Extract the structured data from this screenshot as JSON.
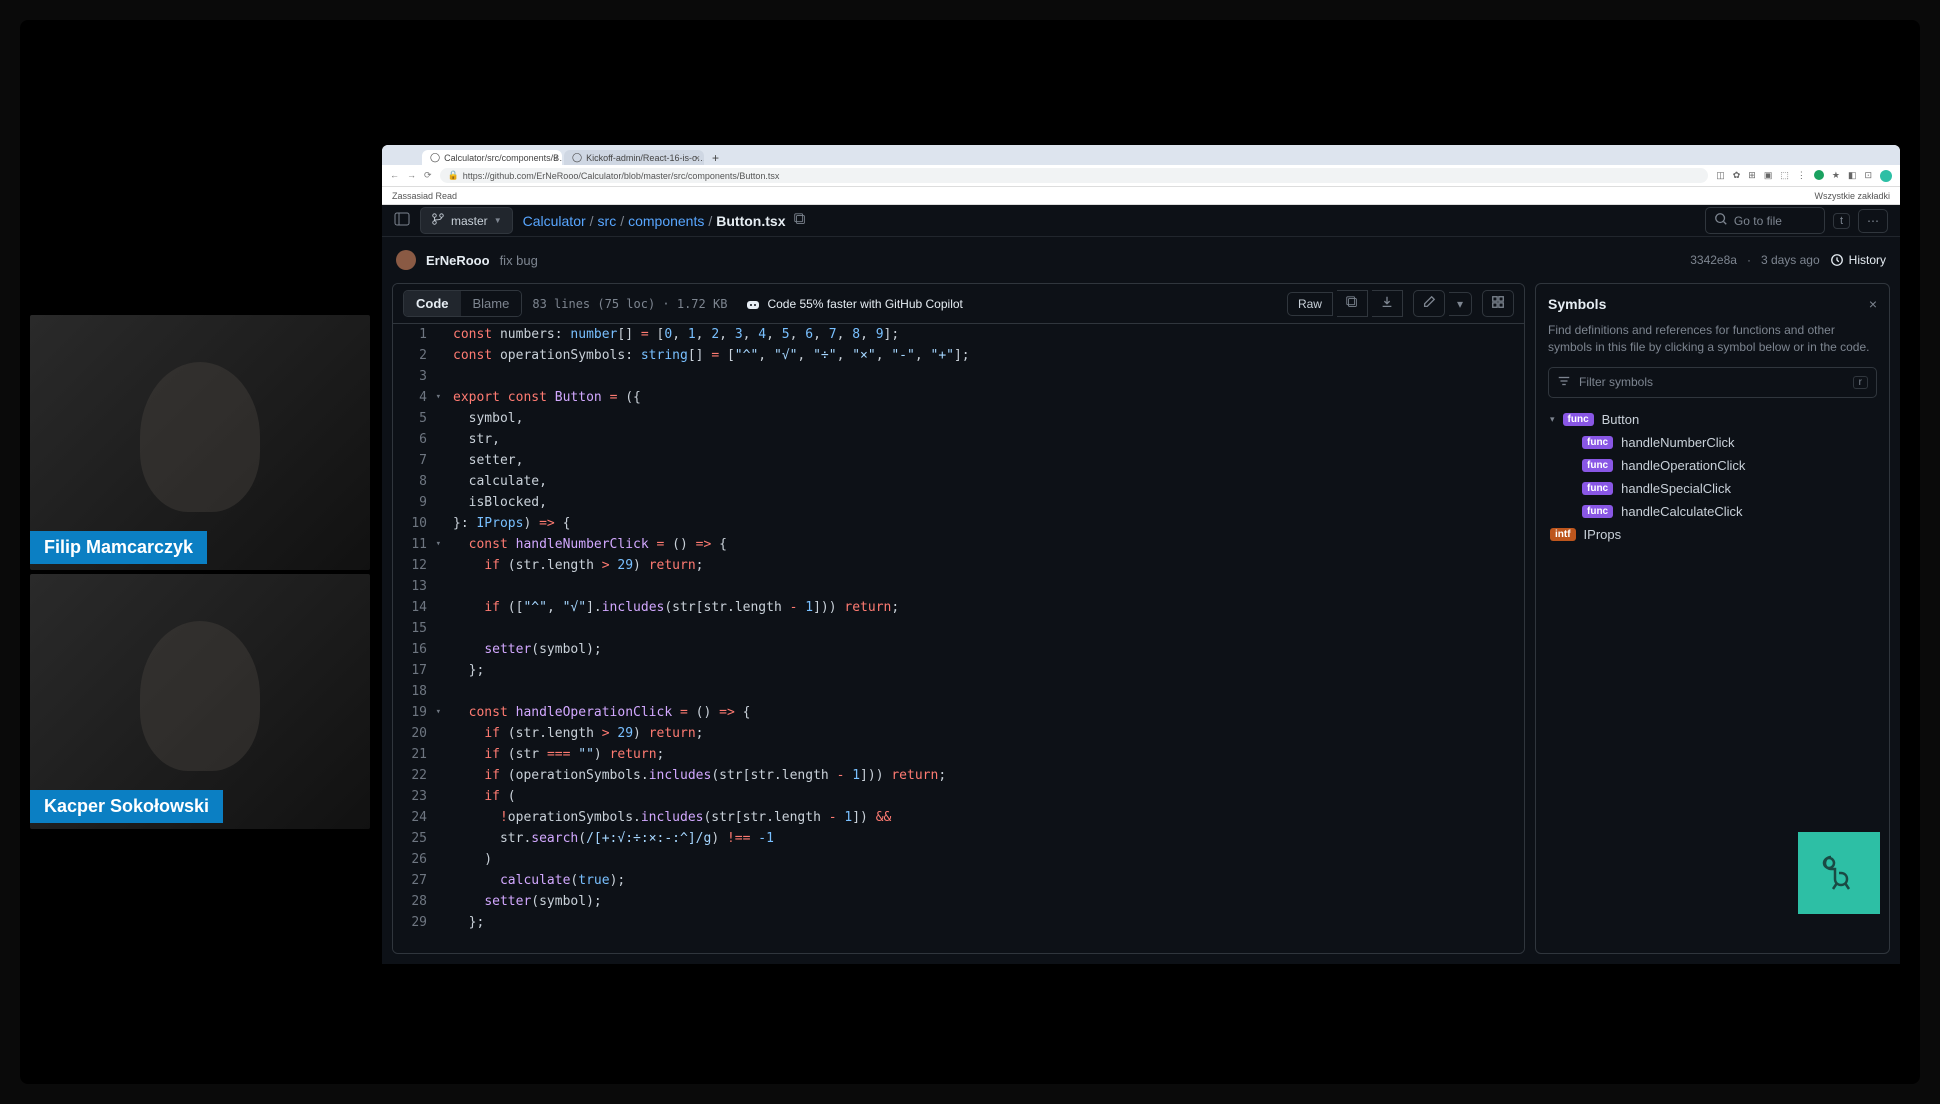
{
  "webcams": [
    {
      "name": "Filip Mamcarczyk"
    },
    {
      "name": "Kacper Sokołowski"
    }
  ],
  "browser": {
    "tabs": [
      {
        "title": "Calculator/src/components/B…",
        "active": true
      },
      {
        "title": "Kickoff-admin/React-16-is-o…",
        "active": false
      }
    ],
    "url": "https://github.com/ErNeRooo/Calculator/blob/master/src/components/Button.tsx",
    "bookmark_left": "Zassasiad Read",
    "bookmark_right": "Wszystkie zakładki"
  },
  "repo": {
    "branch": "master",
    "breadcrumb": {
      "root": "Calculator",
      "dir1": "src",
      "dir2": "components",
      "file": "Button.tsx"
    },
    "goto_placeholder": "Go to file",
    "shortcut_t": "t"
  },
  "commit": {
    "author": "ErNeRooo",
    "message": "fix bug",
    "sha": "3342e8a",
    "age": "3 days ago",
    "history": "History"
  },
  "code_header": {
    "tab_code": "Code",
    "tab_blame": "Blame",
    "file_meta": "83 lines (75 loc) · 1.72 KB",
    "copilot": "Code 55% faster with GitHub Copilot",
    "raw": "Raw"
  },
  "code": [
    {
      "n": 1,
      "fold": "",
      "html": "<span class='kw'>const</span> <span class='vr'>numbers</span>: <span class='ty'>number</span>[] <span class='op'>=</span> [<span class='nm'>0</span>, <span class='nm'>1</span>, <span class='nm'>2</span>, <span class='nm'>3</span>, <span class='nm'>4</span>, <span class='nm'>5</span>, <span class='nm'>6</span>, <span class='nm'>7</span>, <span class='nm'>8</span>, <span class='nm'>9</span>];"
    },
    {
      "n": 2,
      "fold": "",
      "html": "<span class='kw'>const</span> <span class='vr'>operationSymbols</span>: <span class='ty'>string</span>[] <span class='op'>=</span> [<span class='st'>\"^\"</span>, <span class='st'>\"√\"</span>, <span class='st'>\"÷\"</span>, <span class='st'>\"×\"</span>, <span class='st'>\"-\"</span>, <span class='st'>\"+\"</span>];"
    },
    {
      "n": 3,
      "fold": "",
      "html": ""
    },
    {
      "n": 4,
      "fold": "v",
      "html": "<span class='kw'>export</span> <span class='kw'>const</span> <span class='fn'>Button</span> <span class='op'>=</span> ({"
    },
    {
      "n": 5,
      "fold": "",
      "html": "  symbol,"
    },
    {
      "n": 6,
      "fold": "",
      "html": "  str,"
    },
    {
      "n": 7,
      "fold": "",
      "html": "  setter,"
    },
    {
      "n": 8,
      "fold": "",
      "html": "  calculate,"
    },
    {
      "n": 9,
      "fold": "",
      "html": "  isBlocked,"
    },
    {
      "n": 10,
      "fold": "",
      "html": "}: <span class='ty'>IProps</span>) <span class='op'>=&gt;</span> {"
    },
    {
      "n": 11,
      "fold": "v",
      "html": "  <span class='kw'>const</span> <span class='fn'>handleNumberClick</span> <span class='op'>=</span> () <span class='op'>=&gt;</span> {"
    },
    {
      "n": 12,
      "fold": "",
      "html": "    <span class='kw'>if</span> (str.<span class='vr'>length</span> <span class='op'>&gt;</span> <span class='nm'>29</span>) <span class='kw'>return</span>;"
    },
    {
      "n": 13,
      "fold": "",
      "html": ""
    },
    {
      "n": 14,
      "fold": "",
      "html": "    <span class='kw'>if</span> ([<span class='st'>\"^\"</span>, <span class='st'>\"√\"</span>].<span class='fn'>includes</span>(str[str.<span class='vr'>length</span> <span class='op'>-</span> <span class='nm'>1</span>])) <span class='kw'>return</span>;"
    },
    {
      "n": 15,
      "fold": "",
      "html": ""
    },
    {
      "n": 16,
      "fold": "",
      "html": "    <span class='fn'>setter</span>(symbol);"
    },
    {
      "n": 17,
      "fold": "",
      "html": "  };"
    },
    {
      "n": 18,
      "fold": "",
      "html": ""
    },
    {
      "n": 19,
      "fold": "v",
      "html": "  <span class='kw'>const</span> <span class='fn'>handleOperationClick</span> <span class='op'>=</span> () <span class='op'>=&gt;</span> {"
    },
    {
      "n": 20,
      "fold": "",
      "html": "    <span class='kw'>if</span> (str.<span class='vr'>length</span> <span class='op'>&gt;</span> <span class='nm'>29</span>) <span class='kw'>return</span>;"
    },
    {
      "n": 21,
      "fold": "",
      "html": "    <span class='kw'>if</span> (str <span class='op'>===</span> <span class='st'>\"\"</span>) <span class='kw'>return</span>;"
    },
    {
      "n": 22,
      "fold": "",
      "html": "    <span class='kw'>if</span> (operationSymbols.<span class='fn'>includes</span>(str[str.<span class='vr'>length</span> <span class='op'>-</span> <span class='nm'>1</span>])) <span class='kw'>return</span>;"
    },
    {
      "n": 23,
      "fold": "",
      "html": "    <span class='kw'>if</span> ("
    },
    {
      "n": 24,
      "fold": "",
      "html": "      <span class='op'>!</span>operationSymbols.<span class='fn'>includes</span>(str[str.<span class='vr'>length</span> <span class='op'>-</span> <span class='nm'>1</span>]) <span class='op'>&amp;&amp;</span>"
    },
    {
      "n": 25,
      "fold": "",
      "html": "      str.<span class='fn'>search</span>(<span class='st'>/[+:√:÷:×:-:^]/g</span>) <span class='op'>!==</span> <span class='nm'>-1</span>"
    },
    {
      "n": 26,
      "fold": "",
      "html": "    )"
    },
    {
      "n": 27,
      "fold": "",
      "html": "      <span class='fn'>calculate</span>(<span class='nm'>true</span>);"
    },
    {
      "n": 28,
      "fold": "",
      "html": "    <span class='fn'>setter</span>(symbol);"
    },
    {
      "n": 29,
      "fold": "",
      "html": "  };"
    }
  ],
  "symbols": {
    "title": "Symbols",
    "desc": "Find definitions and references for functions and other symbols in this file by clicking a symbol below or in the code.",
    "filter_placeholder": "Filter symbols",
    "shortcut_r": "r",
    "items": [
      {
        "kind": "func",
        "name": "Button",
        "indent": false,
        "disclosure": true
      },
      {
        "kind": "func",
        "name": "handleNumberClick",
        "indent": true
      },
      {
        "kind": "func",
        "name": "handleOperationClick",
        "indent": true
      },
      {
        "kind": "func",
        "name": "handleSpecialClick",
        "indent": true
      },
      {
        "kind": "func",
        "name": "handleCalculateClick",
        "indent": true
      },
      {
        "kind": "intf",
        "name": "IProps",
        "indent": false
      }
    ]
  }
}
